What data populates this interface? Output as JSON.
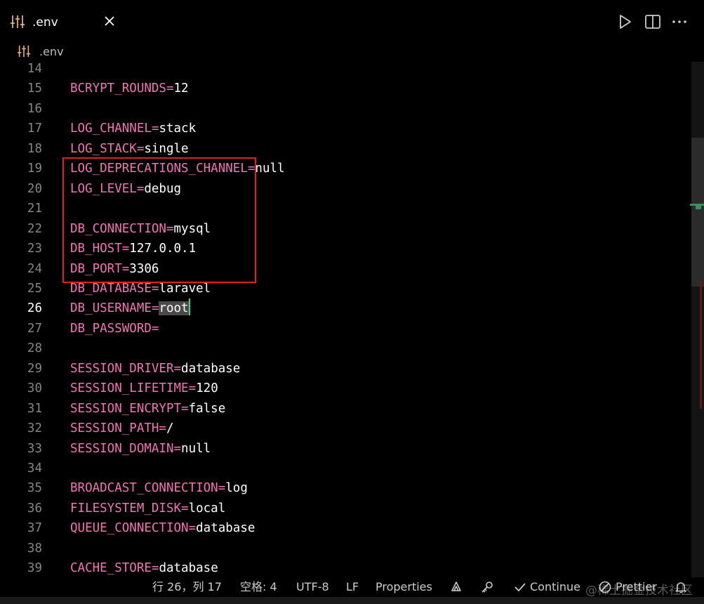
{
  "tab": {
    "title": ".env",
    "file_icon": "settings-sliders-icon"
  },
  "toolbar": {
    "run_icon": "play-icon",
    "split_icon": "split-editor-icon",
    "more_icon": "more-actions-icon"
  },
  "breadcrumb": {
    "file": ".env"
  },
  "editor": {
    "active_line": "26",
    "lines": [
      {
        "n": "14",
        "key": "",
        "value": ""
      },
      {
        "n": "15",
        "key": "BCRYPT_ROUNDS=",
        "value": "12"
      },
      {
        "n": "16",
        "key": "",
        "value": ""
      },
      {
        "n": "17",
        "key": "LOG_CHANNEL=",
        "value": "stack"
      },
      {
        "n": "18",
        "key": "LOG_STACK=",
        "value": "single"
      },
      {
        "n": "19",
        "key": "LOG_DEPRECATIONS_CHANNEL=",
        "value": "null"
      },
      {
        "n": "20",
        "key": "LOG_LEVEL=",
        "value": "debug"
      },
      {
        "n": "21",
        "key": "",
        "value": ""
      },
      {
        "n": "22",
        "key": "DB_CONNECTION=",
        "value": "mysql"
      },
      {
        "n": "23",
        "key": "DB_HOST=",
        "value": "127.0.0.1"
      },
      {
        "n": "24",
        "key": "DB_PORT=",
        "value": "3306"
      },
      {
        "n": "25",
        "key": "DB_DATABASE=",
        "value": "laravel"
      },
      {
        "n": "26",
        "key": "DB_USERNAME=",
        "value": "root"
      },
      {
        "n": "27",
        "key": "DB_PASSWORD=",
        "value": ""
      },
      {
        "n": "28",
        "key": "",
        "value": ""
      },
      {
        "n": "29",
        "key": "SESSION_DRIVER=",
        "value": "database"
      },
      {
        "n": "30",
        "key": "SESSION_LIFETIME=",
        "value": "120"
      },
      {
        "n": "31",
        "key": "SESSION_ENCRYPT=",
        "value": "false"
      },
      {
        "n": "32",
        "key": "SESSION_PATH=",
        "value": "/"
      },
      {
        "n": "33",
        "key": "SESSION_DOMAIN=",
        "value": "null"
      },
      {
        "n": "34",
        "key": "",
        "value": ""
      },
      {
        "n": "35",
        "key": "BROADCAST_CONNECTION=",
        "value": "log"
      },
      {
        "n": "36",
        "key": "FILESYSTEM_DISK=",
        "value": "local"
      },
      {
        "n": "37",
        "key": "QUEUE_CONNECTION=",
        "value": "database"
      },
      {
        "n": "38",
        "key": "",
        "value": ""
      },
      {
        "n": "39",
        "key": "CACHE_STORE=",
        "value": "database"
      }
    ]
  },
  "statusbar": {
    "position": "行 26，列 17",
    "indent": "空格: 4",
    "encoding": "UTF-8",
    "eol": "LF",
    "language": "Properties",
    "continue": "Continue",
    "prettier": "Prettier"
  },
  "watermark": "@稀土掘金技术社区",
  "colors": {
    "key": "#f472b6",
    "value": "#ffffff",
    "highlight_box": "#e02020",
    "cursor": "#3ddc84"
  }
}
